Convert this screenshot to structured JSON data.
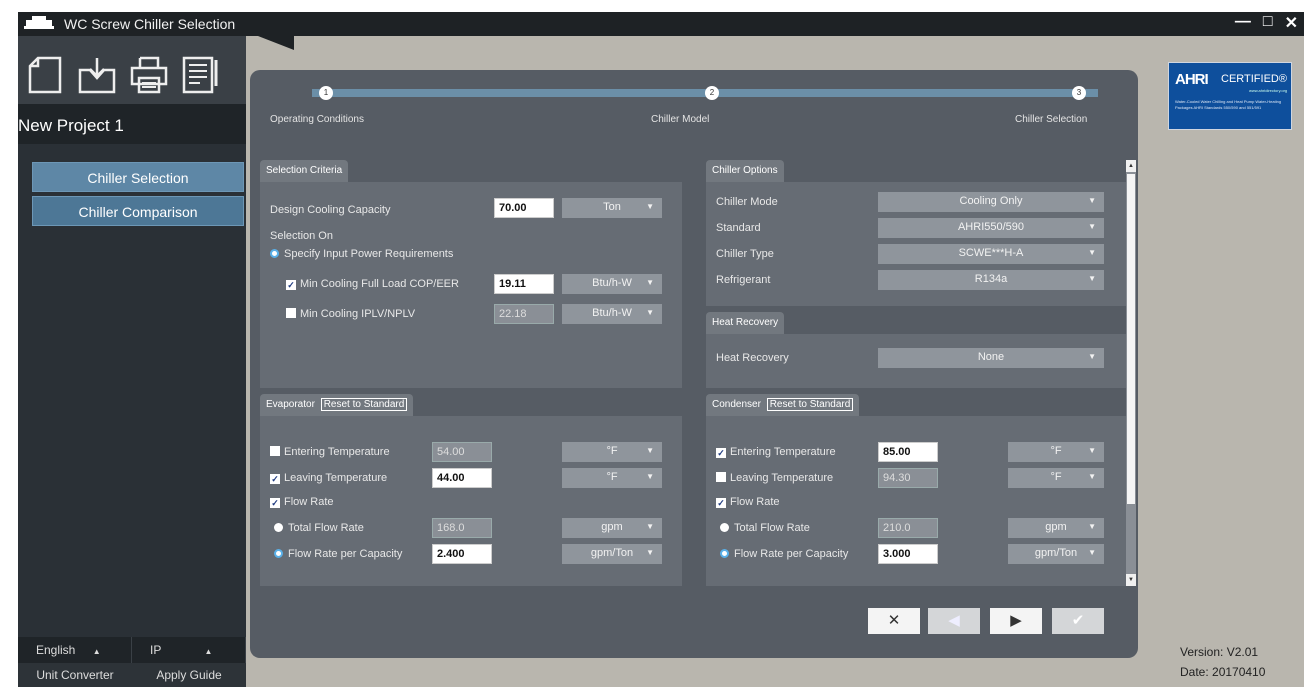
{
  "app": {
    "title": "WC Screw Chiller Selection",
    "window_controls": {
      "minimize": "—",
      "maximize": "□",
      "close": "✕"
    }
  },
  "sidebar": {
    "toolbar_icons": [
      "new-file-icon",
      "save-icon",
      "print-icon",
      "report-icon"
    ],
    "project_title": "New Project 1",
    "nav": [
      {
        "label": "Chiller Selection",
        "active": true
      },
      {
        "label": "Chiller Comparison",
        "active": false
      }
    ],
    "language": "English",
    "units": "IP",
    "links": {
      "unit_converter": "Unit Converter",
      "apply_guide": "Apply Guide"
    }
  },
  "steps": [
    {
      "num": "1",
      "label": "Operating Conditions"
    },
    {
      "num": "2",
      "label": "Chiller Model"
    },
    {
      "num": "3",
      "label": "Chiller Selection"
    }
  ],
  "selection_criteria": {
    "tab": "Selection Criteria",
    "design_capacity_label": "Design Cooling Capacity",
    "design_capacity_value": "70.00",
    "design_capacity_unit": "Ton",
    "selection_on_label": "Selection On",
    "specify_power_label": "Specify Input Power Requirements",
    "min_full_load_label": "Min Cooling Full Load COP/EER",
    "min_full_load_value": "19.11",
    "min_full_load_unit": "Btu/h-W",
    "min_iplv_label": "Min Cooling IPLV/NPLV",
    "min_iplv_value": "22.18",
    "min_iplv_unit": "Btu/h-W"
  },
  "chiller_options": {
    "tab": "Chiller Options",
    "rows": [
      {
        "label": "Chiller Mode",
        "value": "Cooling Only"
      },
      {
        "label": "Standard",
        "value": "AHRI550/590"
      },
      {
        "label": "Chiller Type",
        "value": "SCWE***H-A"
      },
      {
        "label": "Refrigerant",
        "value": "R134a"
      }
    ]
  },
  "heat_recovery": {
    "tab": "Heat Recovery",
    "label": "Heat Recovery",
    "value": "None"
  },
  "evaporator": {
    "tab": "Evaporator",
    "reset": "Reset to Standard",
    "entering_label": "Entering Temperature",
    "entering_value": "54.00",
    "entering_unit": "°F",
    "leaving_label": "Leaving Temperature",
    "leaving_value": "44.00",
    "leaving_unit": "°F",
    "flow_rate_label": "Flow Rate",
    "total_flow_label": "Total Flow Rate",
    "total_flow_value": "168.0",
    "total_flow_unit": "gpm",
    "per_capacity_label": "Flow Rate per Capacity",
    "per_capacity_value": "2.400",
    "per_capacity_unit": "gpm/Ton"
  },
  "condenser": {
    "tab": "Condenser",
    "reset": "Reset to Standard",
    "entering_label": "Entering Temperature",
    "entering_value": "85.00",
    "entering_unit": "°F",
    "leaving_label": "Leaving Temperature",
    "leaving_value": "94.30",
    "leaving_unit": "°F",
    "flow_rate_label": "Flow Rate",
    "total_flow_label": "Total Flow Rate",
    "total_flow_value": "210.0",
    "total_flow_unit": "gpm",
    "per_capacity_label": "Flow Rate per Capacity",
    "per_capacity_value": "3.000",
    "per_capacity_unit": "gpm/Ton"
  },
  "nav_buttons": {
    "cancel": "✕",
    "back": "◀",
    "next": "▶",
    "finish": "✔"
  },
  "badge": {
    "brand": "AHRI",
    "certified": "CERTIFIED®",
    "site": "www.ahridirectory.org",
    "fine_print": "Water-Cooled Water Chilling and Heat Pump Water-Heating Packages AHRI Standards 550/590 and 551/591"
  },
  "version": {
    "version": "Version: V2.01",
    "date": "Date: 20170410"
  },
  "colors": {
    "accent": "#4d7796",
    "panel": "#666c74",
    "main": "#565c64",
    "badge": "#0e4f9c"
  }
}
